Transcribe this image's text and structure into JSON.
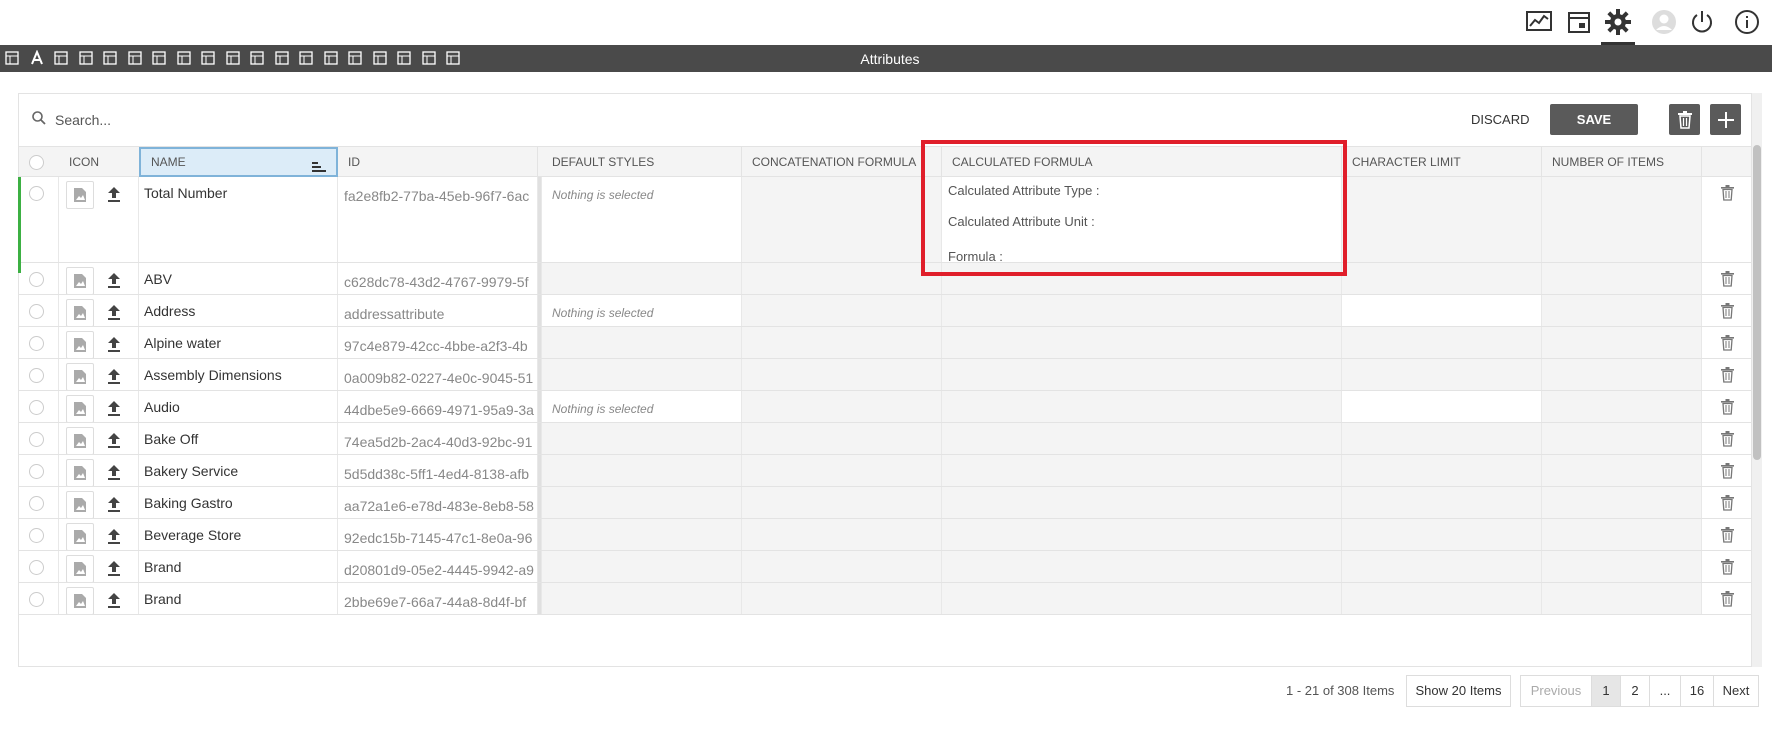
{
  "toolbar": {
    "title": "Attributes",
    "icons": [
      "tag-icon",
      "text-icon",
      "label-icon",
      "calendar-icon",
      "checklist-icon",
      "table-icon",
      "card-icon",
      "layout-icon",
      "tags-icon",
      "grid-icon",
      "check-circle-icon",
      "network-icon",
      "user-icon",
      "stamp-icon",
      "gear-user-icon",
      "document-icon",
      "list-icon",
      "translate-icon",
      "document-image-icon"
    ]
  },
  "topbar": {
    "icons": [
      "chart-icon",
      "calendar-box-icon",
      "gear-icon",
      "profile-icon",
      "power-icon",
      "info-icon"
    ]
  },
  "search": {
    "placeholder": "Search..."
  },
  "actions": {
    "discard": "DISCARD",
    "save": "SAVE"
  },
  "columns": {
    "icon": "ICON",
    "name": "NAME",
    "id": "ID",
    "default_styles": "DEFAULT STYLES",
    "concatenation_formula": "CONCATENATION FORMULA",
    "calculated_formula": "CALCULATED FORMULA",
    "character_limit": "CHARACTER LIMIT",
    "number_of_items": "NUMBER OF ITEMS"
  },
  "expanded_row": {
    "calc_type": "Calculated Attribute Type :",
    "calc_unit": "Calculated Attribute Unit :",
    "formula": "Formula :"
  },
  "nothing_selected": "Nothing is selected",
  "rows": [
    {
      "name": "Total Number",
      "id": "fa2e8fb2-77ba-45eb-96f7-6ac",
      "default_styles": "Nothing is selected"
    },
    {
      "name": "ABV",
      "id": "c628dc78-43d2-4767-9979-5f",
      "default_styles": ""
    },
    {
      "name": "Address",
      "id": "addressattribute",
      "default_styles": "Nothing is selected"
    },
    {
      "name": "Alpine water",
      "id": "97c4e879-42cc-4bbe-a2f3-4b",
      "default_styles": ""
    },
    {
      "name": "Assembly Dimensions",
      "id": "0a009b82-0227-4e0c-9045-51",
      "default_styles": ""
    },
    {
      "name": "Audio",
      "id": "44dbe5e9-6669-4971-95a9-3a",
      "default_styles": "Nothing is selected"
    },
    {
      "name": "Bake Off",
      "id": "74ea5d2b-2ac4-40d3-92bc-91",
      "default_styles": ""
    },
    {
      "name": "Bakery Service",
      "id": "5d5dd38c-5ff1-4ed4-8138-afb",
      "default_styles": ""
    },
    {
      "name": "Baking Gastro",
      "id": "aa72a1e6-e78d-483e-8eb8-58",
      "default_styles": ""
    },
    {
      "name": "Beverage Store",
      "id": "92edc15b-7145-47c1-8e0a-96",
      "default_styles": ""
    },
    {
      "name": "Brand",
      "id": "d20801d9-05e2-4445-9942-a9",
      "default_styles": ""
    },
    {
      "name": "Brand",
      "id": "2bbe69e7-66a7-44a8-8d4f-bf",
      "default_styles": ""
    }
  ],
  "pager": {
    "info": "1 - 21 of 308 Items",
    "show": "Show 20 Items",
    "previous": "Previous",
    "pages": [
      "1",
      "2",
      "...",
      "16"
    ],
    "next": "Next"
  }
}
